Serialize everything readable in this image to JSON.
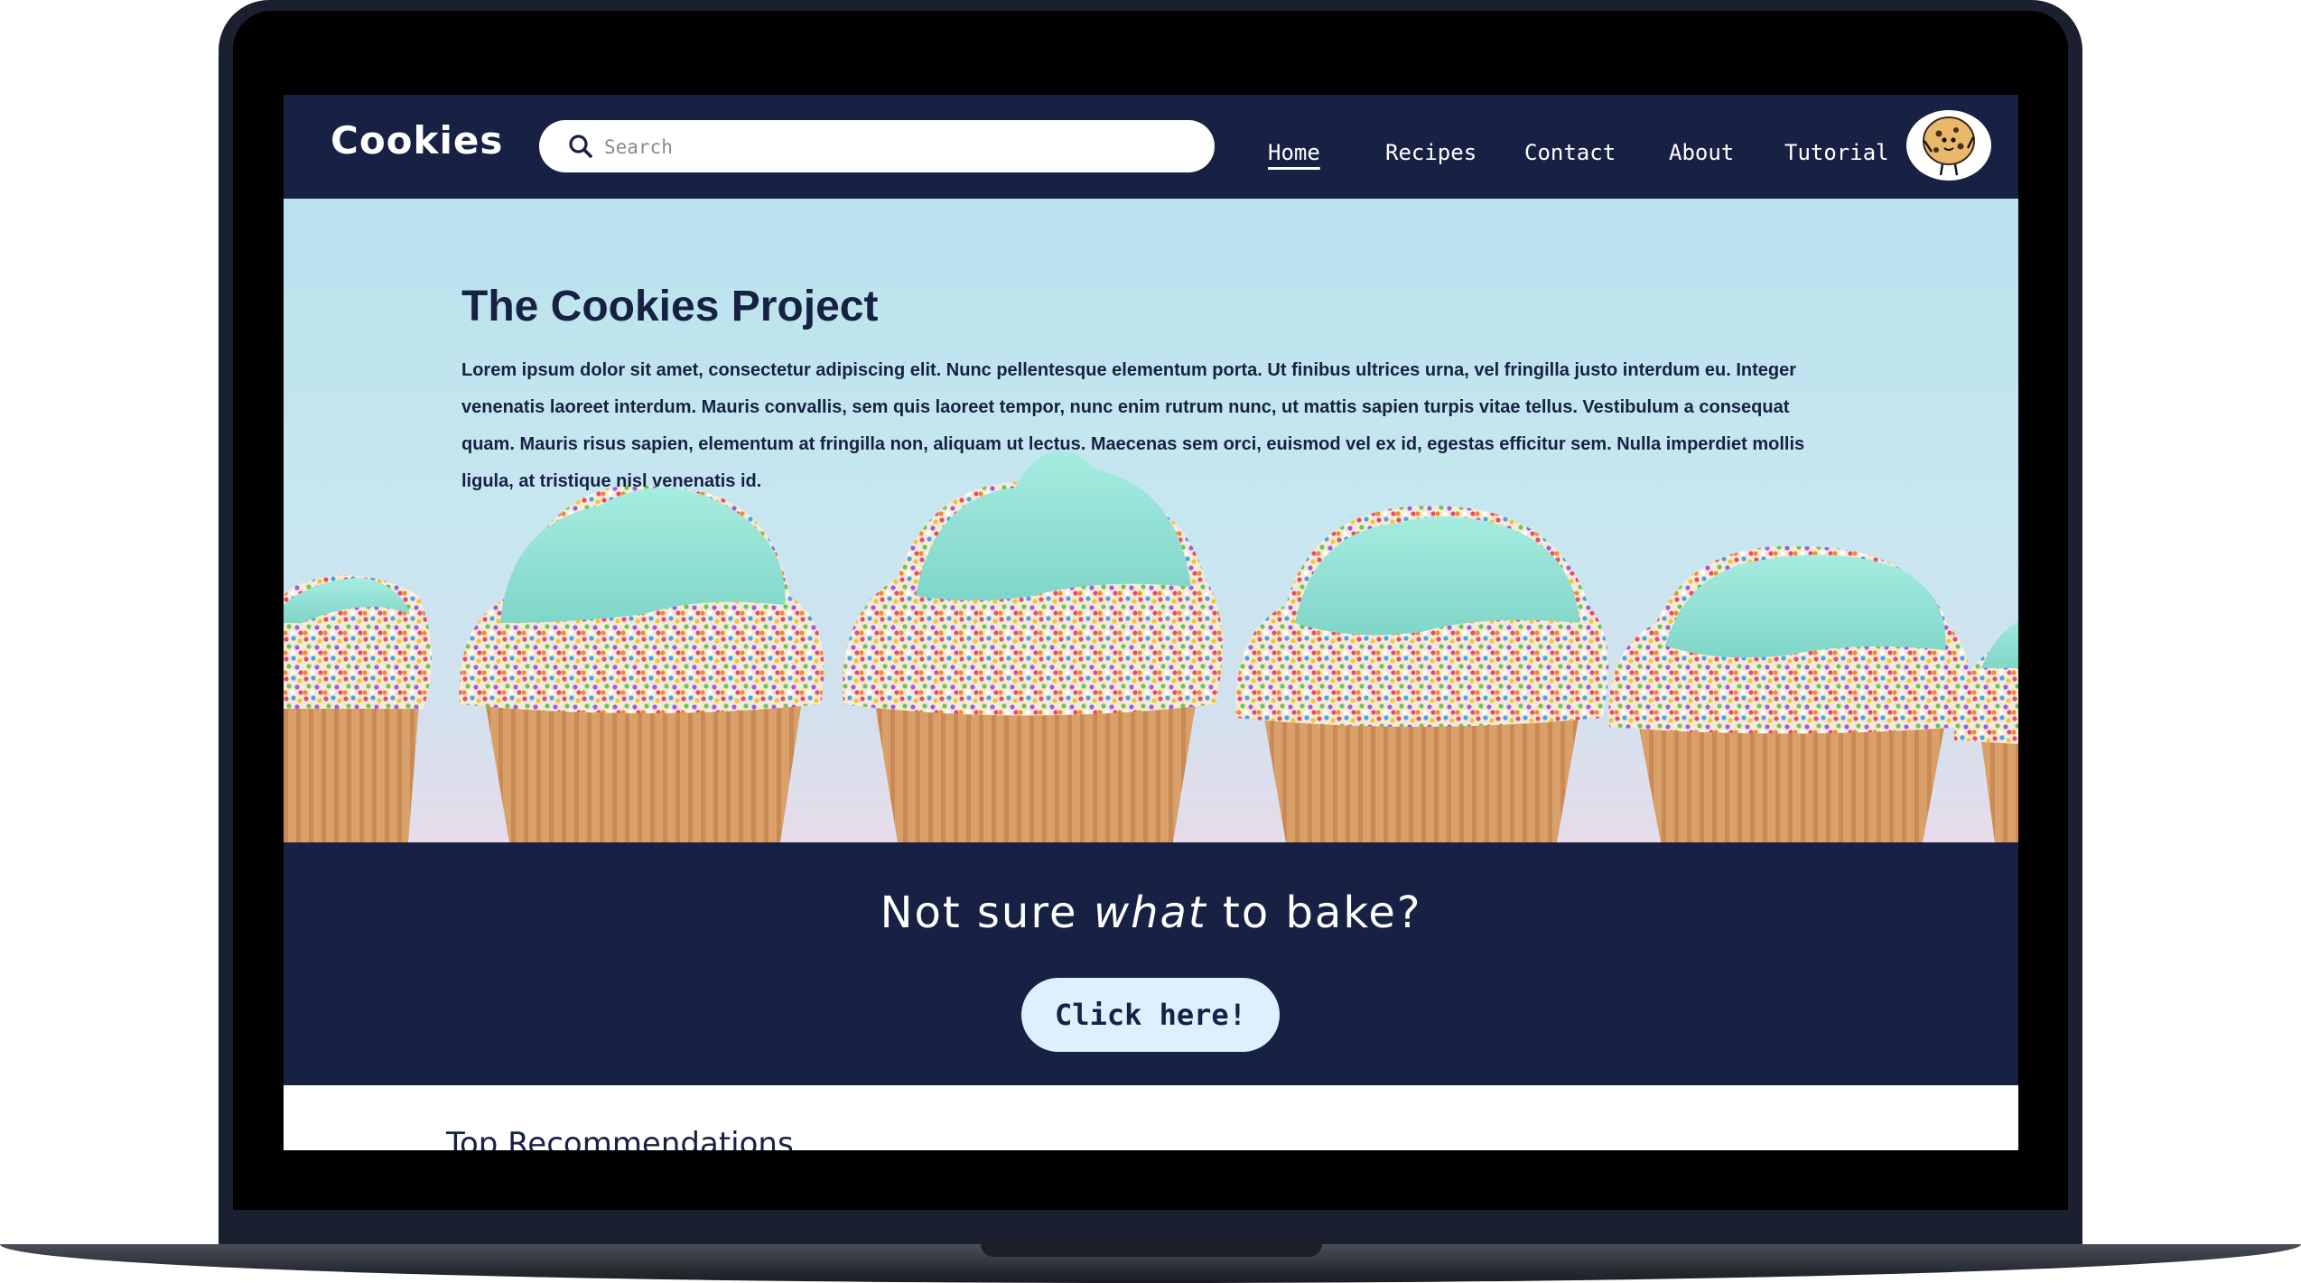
{
  "header": {
    "brand": "Cookies",
    "search": {
      "placeholder": "Search",
      "value": ""
    },
    "nav": [
      {
        "label": "Home",
        "active": true
      },
      {
        "label": "Recipes",
        "active": false
      },
      {
        "label": "Contact",
        "active": false
      },
      {
        "label": "About",
        "active": false
      },
      {
        "label": "Tutorial",
        "active": false
      }
    ],
    "avatar_icon": "cookie-mascot-icon"
  },
  "hero": {
    "title": "The Cookies Project",
    "body": "Lorem ipsum dolor sit amet, consectetur adipiscing elit. Nunc pellentesque elementum porta. Ut finibus ultrices urna, vel fringilla justo interdum eu. Integer venenatis laoreet interdum. Mauris convallis, sem quis laoreet tempor, nunc enim rutrum nunc, ut mattis sapien turpis vitae tellus. Vestibulum a consequat quam. Mauris risus sapien, elementum at fringilla non, aliquam ut lectus. Maecenas sem orci, euismod vel ex id, egestas efficitur sem. Nulla imperdiet mollis ligula, at tristique nisl venenatis id.",
    "image": "cupcakes-photo"
  },
  "cta": {
    "title_before": "Not sure ",
    "title_emphasis": "what",
    "title_after": " to bake?",
    "button_label": "Click here!"
  },
  "recommendations": {
    "title": "Top Recommendations"
  },
  "colors": {
    "navy": "#172143",
    "button_bg": "#ddf0ff",
    "frosting": "#8edfd2",
    "hero_bg": "#c2e5ee"
  }
}
